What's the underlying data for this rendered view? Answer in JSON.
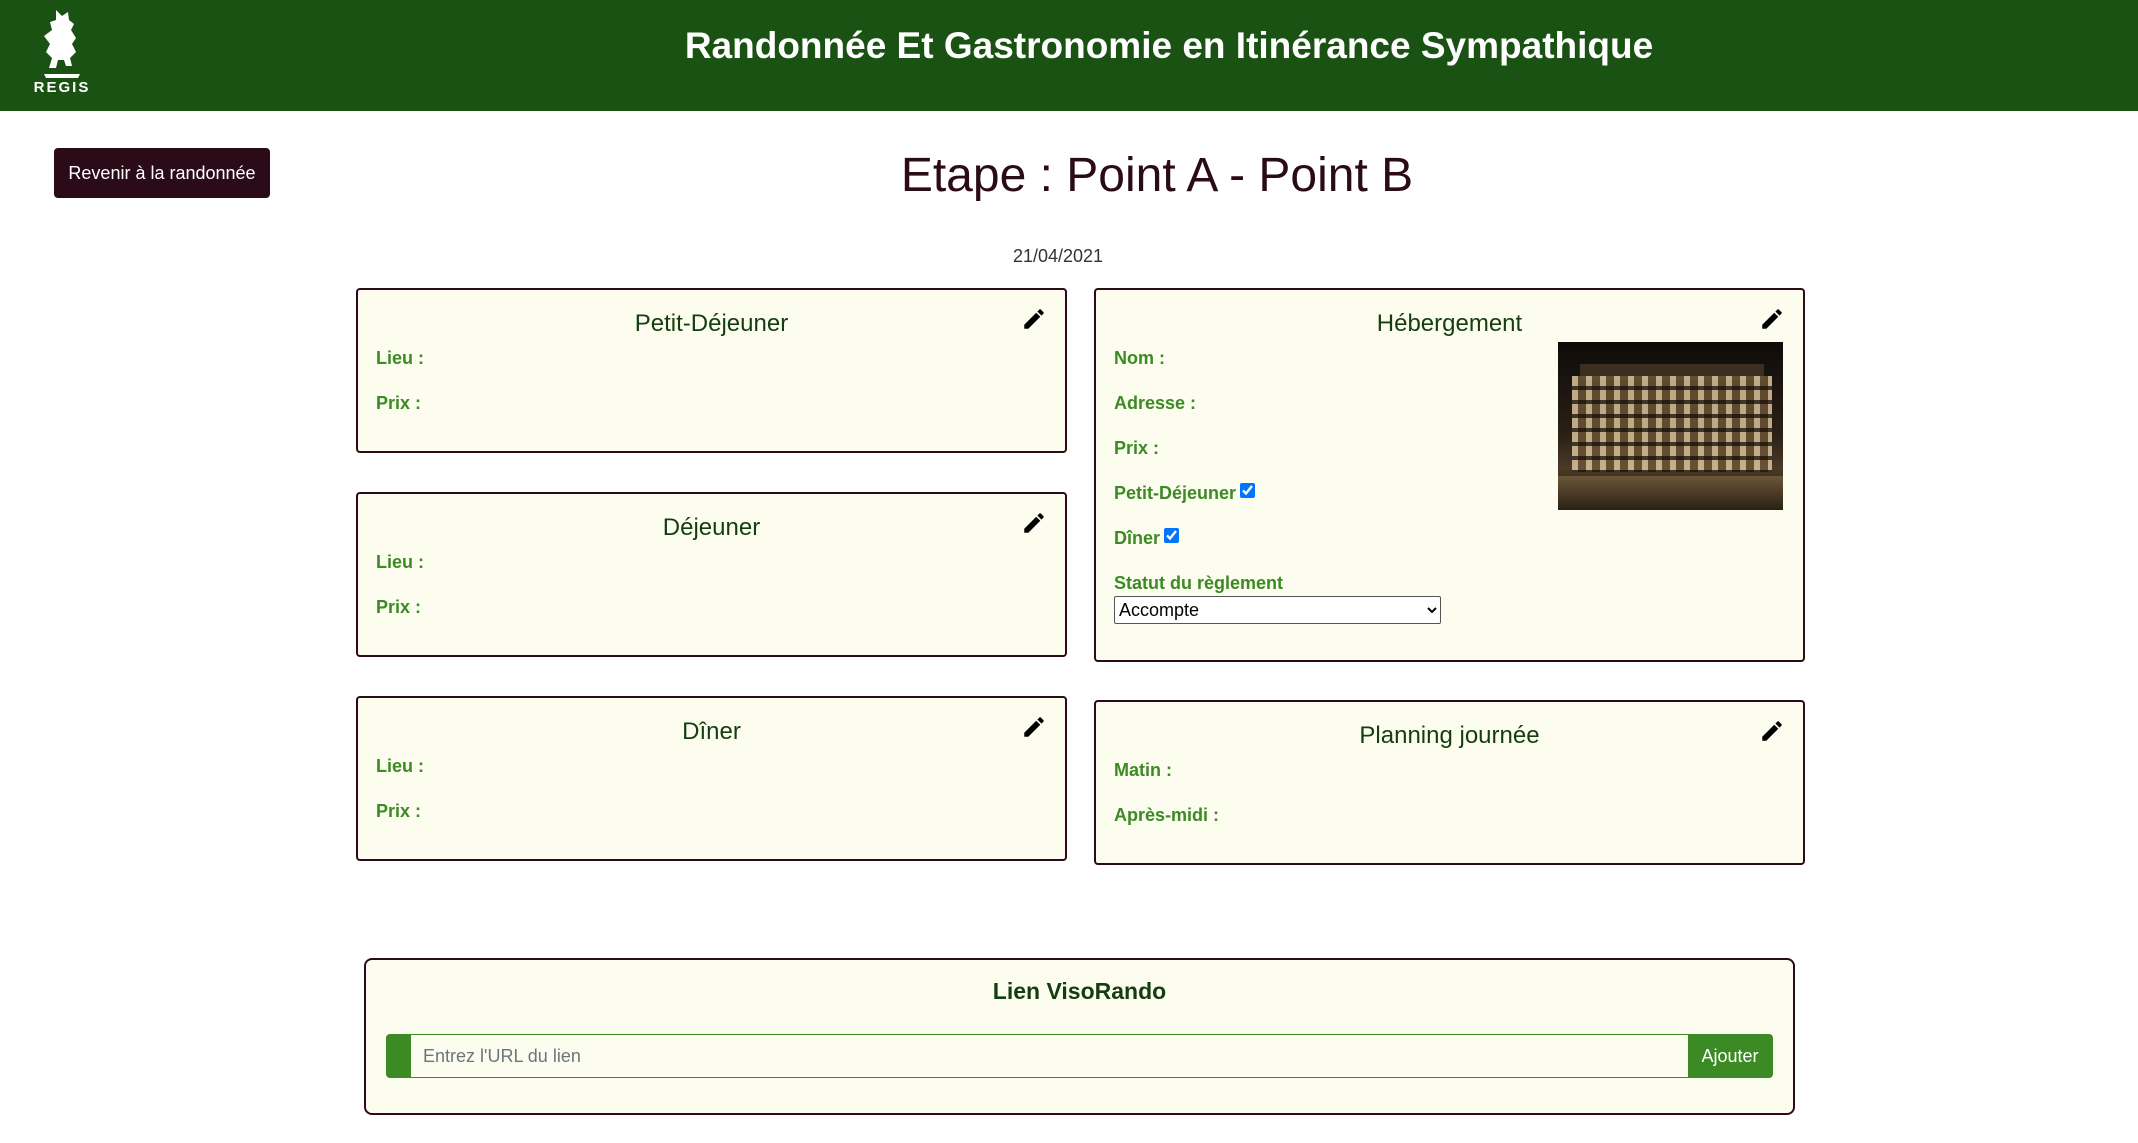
{
  "header": {
    "logo_text": "REGIS",
    "title": "Randonnée Et Gastronomie en Itinérance Sympathique"
  },
  "back_button": "Revenir à la randonnée",
  "page_title": "Etape : Point A - Point B",
  "date": "21/04/2021",
  "meals": {
    "breakfast": {
      "title": "Petit-Déjeuner",
      "lieu_label": "Lieu :",
      "prix_label": "Prix :"
    },
    "lunch": {
      "title": "Déjeuner",
      "lieu_label": "Lieu :",
      "prix_label": "Prix :"
    },
    "dinner": {
      "title": "Dîner",
      "lieu_label": "Lieu :",
      "prix_label": "Prix :"
    }
  },
  "accommodation": {
    "title": "Hébergement",
    "nom_label": "Nom :",
    "adresse_label": "Adresse :",
    "prix_label": "Prix :",
    "breakfast_label": "Petit-Déjeuner",
    "breakfast_checked": true,
    "dinner_label": "Dîner",
    "dinner_checked": true,
    "payment_status_label": "Statut du règlement",
    "payment_status_value": "Accompte"
  },
  "planning": {
    "title": "Planning journée",
    "matin_label": "Matin :",
    "apres_midi_label": "Après-midi :"
  },
  "visorando": {
    "title": "Lien VisoRando",
    "input_placeholder": "Entrez l'URL du lien",
    "button_label": "Ajouter"
  },
  "colors": {
    "header_bg": "#1a5213",
    "accent_dark": "#2b0b18",
    "label_green": "#3b8a23",
    "card_bg": "#fcfdef"
  },
  "icons": {
    "logo": "bear-logo-icon",
    "edit": "pencil-icon"
  }
}
